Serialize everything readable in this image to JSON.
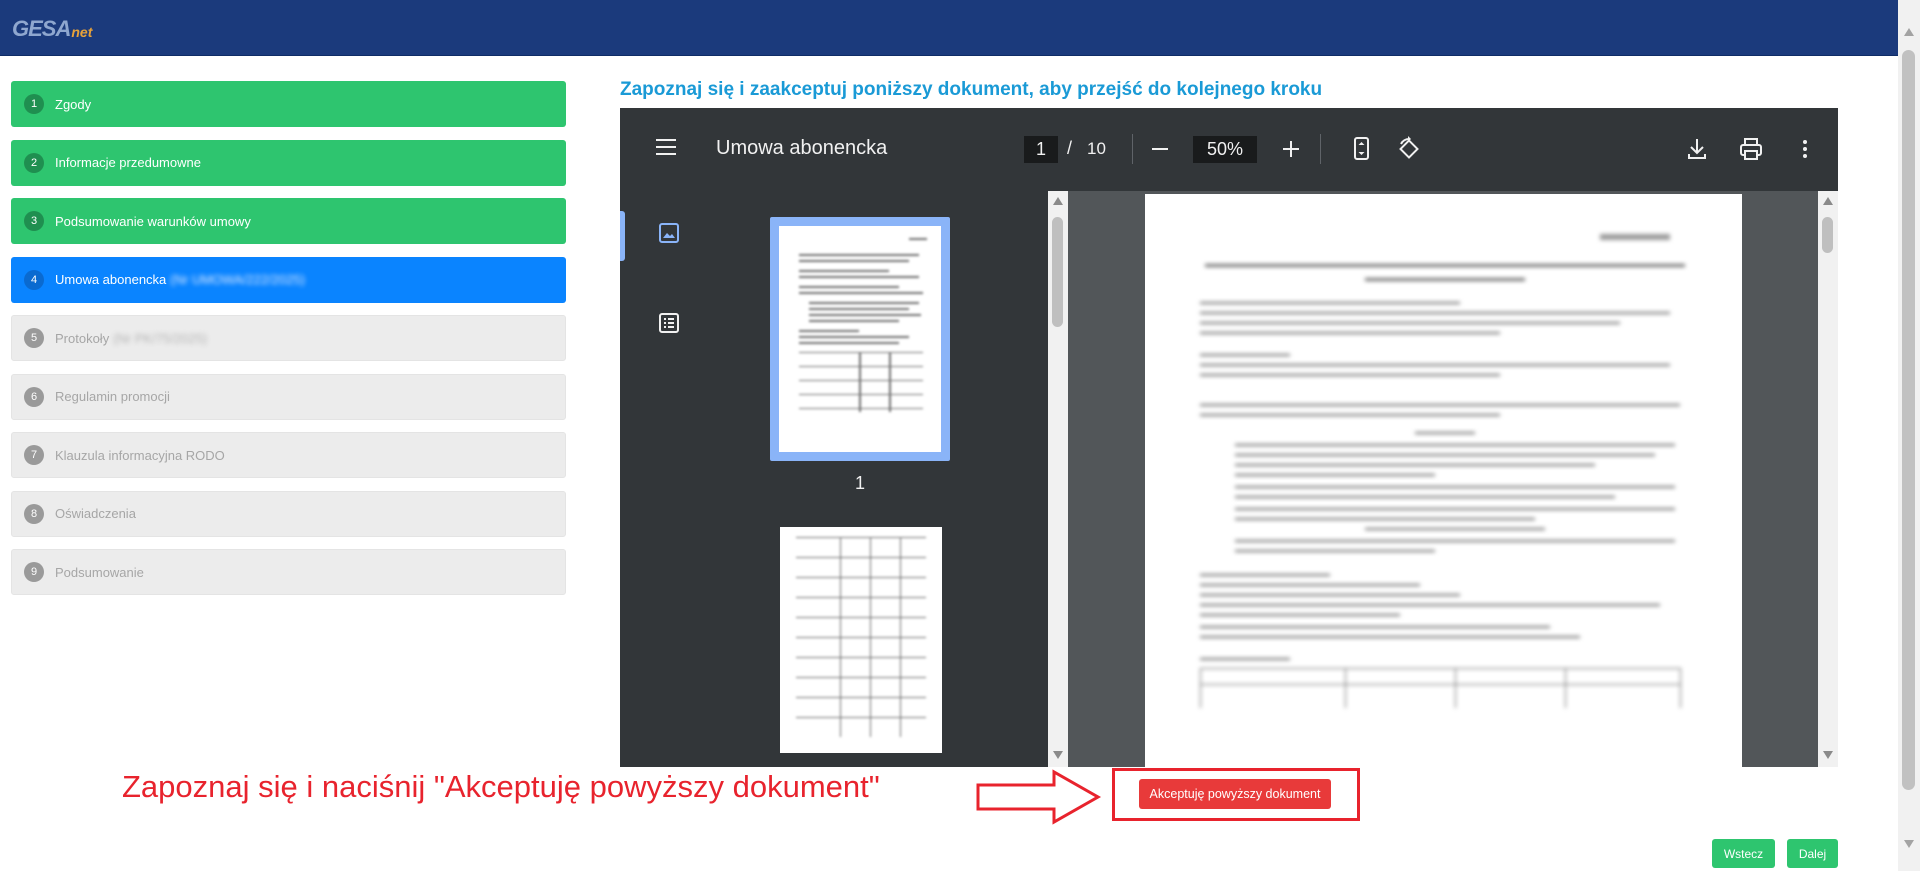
{
  "header": {
    "logo_main": "GESA",
    "logo_sub": "net",
    "bar_color": "#1b3a7c"
  },
  "steps": [
    {
      "num": "1",
      "label": "Zgody",
      "suffix": "",
      "state": "done"
    },
    {
      "num": "2",
      "label": "Informacje przedumowne",
      "suffix": "",
      "state": "done"
    },
    {
      "num": "3",
      "label": "Podsumowanie warunków umowy",
      "suffix": "",
      "state": "done"
    },
    {
      "num": "4",
      "label": "Umowa abonencka",
      "suffix": "(Nr UMOWA/222/2025)",
      "state": "active"
    },
    {
      "num": "5",
      "label": "Protokoły",
      "suffix": "(Nr PK/75/2025)",
      "state": "pending"
    },
    {
      "num": "6",
      "label": "Regulamin promocji",
      "suffix": "",
      "state": "pending"
    },
    {
      "num": "7",
      "label": "Klauzula informacyjna RODO",
      "suffix": "",
      "state": "pending"
    },
    {
      "num": "8",
      "label": "Oświadczenia",
      "suffix": "",
      "state": "pending"
    },
    {
      "num": "9",
      "label": "Podsumowanie",
      "suffix": "",
      "state": "pending"
    }
  ],
  "instruction": "Zapoznaj się i zaakceptuj poniższy dokument, aby przejść do kolejnego kroku",
  "viewer": {
    "doc_title": "Umowa abonencka",
    "current_page": "1",
    "page_separator": "/",
    "total_pages": "10",
    "zoom": "50%",
    "thumbnail_label": "1",
    "icons": [
      "menu-icon",
      "zoom-out-icon",
      "zoom-in-icon",
      "fit-page-icon",
      "rotate-icon",
      "download-icon",
      "print-icon",
      "more-vert-icon",
      "thumbnails-icon",
      "outline-icon"
    ]
  },
  "annotation": {
    "note": "Zapoznaj się i naciśnij \"Akceptuję powyższy dokument\"",
    "color": "#e8232d"
  },
  "buttons": {
    "accept": "Akceptuję powyższy dokument",
    "back": "Wstecz",
    "next": "Dalej"
  },
  "colors": {
    "done": "#2ec56f",
    "active": "#0a84ff",
    "pending": "#ececec",
    "accept": "#e83a3a"
  }
}
